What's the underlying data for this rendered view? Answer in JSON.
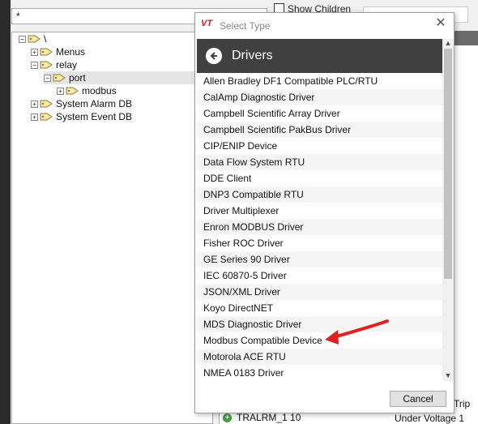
{
  "background": {
    "filter_value": "*",
    "show_children_label": "Show Children",
    "tree": [
      {
        "label": "\\",
        "expander": "−"
      },
      {
        "label": "Menus",
        "expander": "+"
      },
      {
        "label": "relay",
        "expander": "−"
      },
      {
        "label": "port",
        "expander": "−"
      },
      {
        "label": "modbus",
        "expander": "+"
      },
      {
        "label": "System Alarm DB",
        "expander": "+"
      },
      {
        "label": "System Event DB",
        "expander": "+"
      }
    ],
    "bottom_row_name": "TRALRM_1 10",
    "bottom_row_desc": "Under Voltage 1",
    "trip_text": "Trip"
  },
  "dialog": {
    "logo_text": "VT",
    "title": "Select Type",
    "close_glyph": "✕",
    "section_title": "Drivers",
    "items": [
      "Allen Bradley DF1 Compatible PLC/RTU",
      "CalAmp Diagnostic Driver",
      "Campbell Scientific Array Driver",
      "Campbell Scientific PakBus Driver",
      "CIP/ENIP Device",
      "Data Flow System RTU",
      "DDE Client",
      "DNP3 Compatible RTU",
      "Driver Multiplexer",
      "Enron MODBUS Driver",
      "Fisher ROC Driver",
      "GE Series 90 Driver",
      "IEC 60870-5 Driver",
      "JSON/XML Driver",
      "Koyo DirectNET",
      "MDS Diagnostic Driver",
      "Modbus Compatible Device",
      "Motorola ACE RTU",
      "NMEA 0183 Driver"
    ],
    "cancel_label": "Cancel"
  },
  "colors": {
    "header_bg": "#404040",
    "annotation_arrow": "#e02020",
    "logo_red": "#c0202a"
  },
  "icons": {
    "back": "back-arrow-circle-icon",
    "tree_tag": "tag-icon",
    "close": "close-icon"
  }
}
